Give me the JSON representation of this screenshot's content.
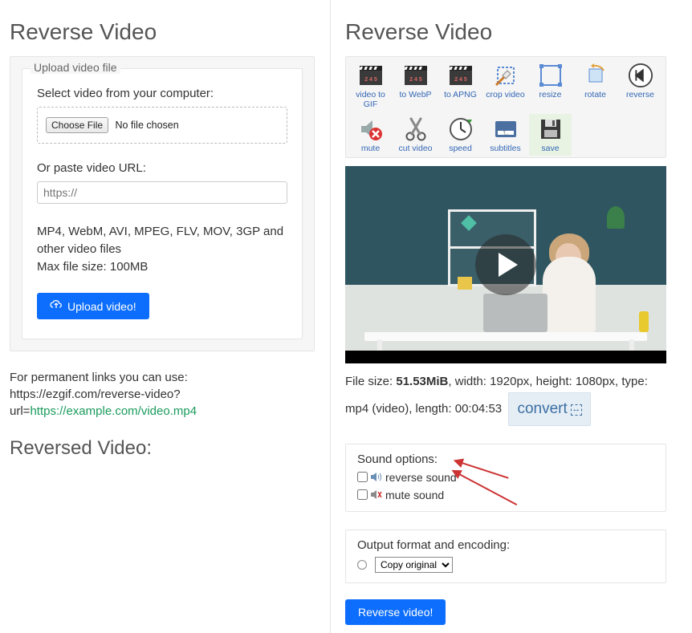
{
  "left": {
    "title": "Reverse Video",
    "fieldset_legend": "Upload video file",
    "select_label": "Select video from your computer:",
    "choose_file_btn": "Choose File",
    "no_file": "No file chosen",
    "or_label": "Or paste video URL:",
    "url_placeholder": "https://",
    "formats_line1": "MP4, WebM, AVI, MPEG, FLV, MOV, 3GP and other video files",
    "formats_line2": "Max file size: 100MB",
    "upload_btn": "Upload video!",
    "permalink_prefix": "For permanent links you can use: https://ezgif.com/reverse-video?url=",
    "permalink_example": "https://example.com/video.mp4",
    "reversed_title": "Reversed Video:"
  },
  "right": {
    "title": "Reverse Video",
    "tools": [
      {
        "label": "video to GIF",
        "icon": "clapper"
      },
      {
        "label": "to WebP",
        "icon": "clapper"
      },
      {
        "label": "to APNG",
        "icon": "clapper"
      },
      {
        "label": "crop video",
        "icon": "crop"
      },
      {
        "label": "resize",
        "icon": "resize"
      },
      {
        "label": "rotate",
        "icon": "rotate"
      },
      {
        "label": "reverse",
        "icon": "reverse"
      },
      {
        "label": "mute",
        "icon": "mute"
      },
      {
        "label": "cut video",
        "icon": "cut"
      },
      {
        "label": "speed",
        "icon": "speed"
      },
      {
        "label": "subtitles",
        "icon": "subtitles"
      },
      {
        "label": "save",
        "icon": "save",
        "active": true
      }
    ],
    "meta": {
      "prefix": "File size: ",
      "size": "51.53MiB",
      "dims": ", width: 1920px, height: 1080px, type: mp4 (video), length: 00:04:53",
      "convert": "convert"
    },
    "sound_heading": "Sound options:",
    "sound_reverse": "reverse sound",
    "sound_mute": "mute sound",
    "output_heading": "Output format and encoding:",
    "output_select": "Copy original",
    "submit": "Reverse video!"
  }
}
